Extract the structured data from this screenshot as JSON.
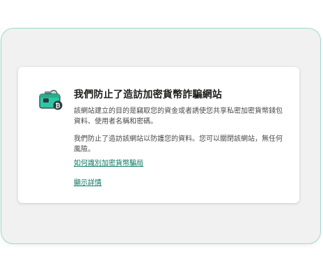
{
  "colors": {
    "accent": "#0f7a63",
    "frame_border": "#9fd9cf",
    "icon_green": "#2fc7a3",
    "icon_dark": "#2e3a3d"
  },
  "warning": {
    "icon": "crypto-wallet-icon",
    "title": "我們防止了造訪加密貨幣詐騙網站",
    "description": "該網站建立的目的是竊取您的資金或者誘使您共享私密加密貨幣錢包資料、使用者名稱和密碼。",
    "protection_text": "我們防止了造訪該網站以防護您的資料。您可以關閉該網站，無任何風險。",
    "learn_link": "如何識別加密貨幣騙局",
    "details_link": "顯示詳情"
  }
}
